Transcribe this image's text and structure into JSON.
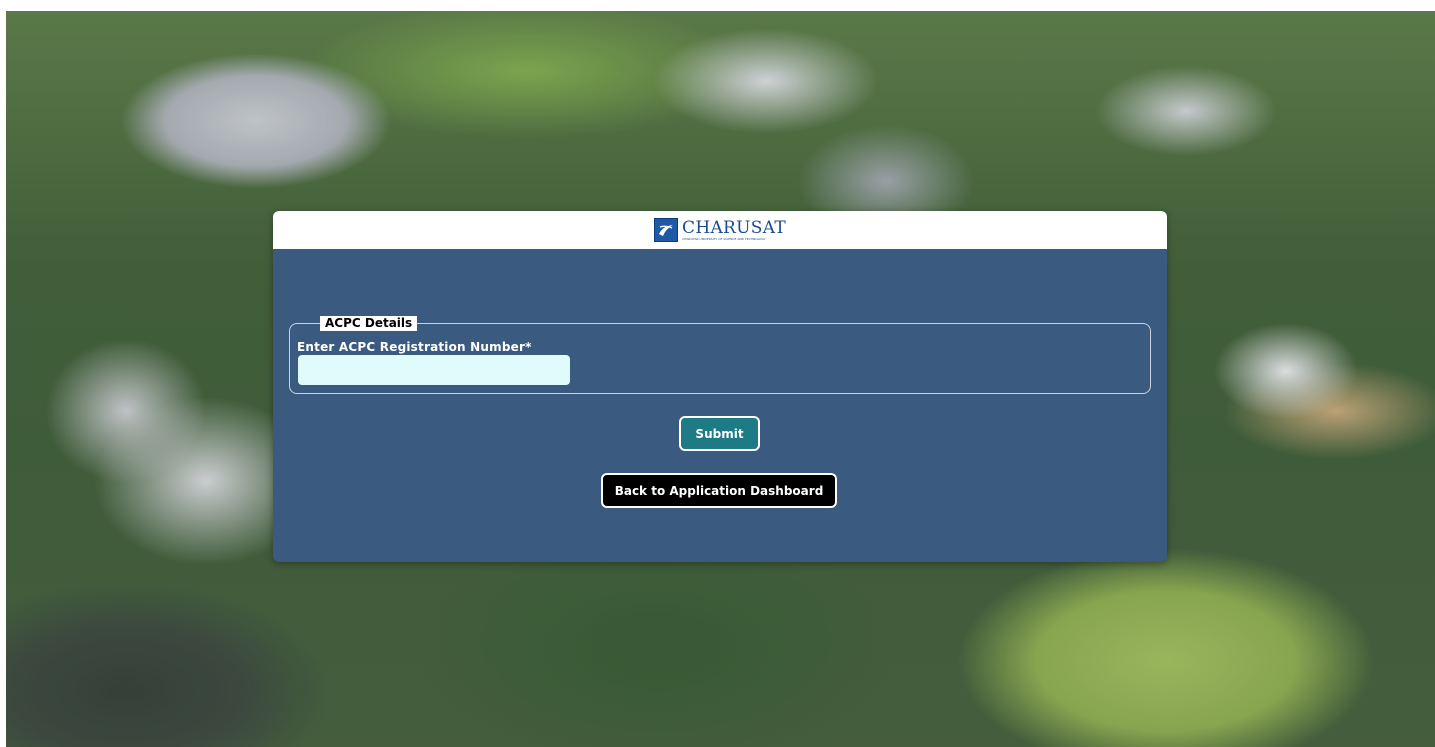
{
  "brand": {
    "name": "CHARUSAT",
    "subtitle": "CHAROTAR UNIVERSITY OF SCIENCE AND TECHNOLOGY"
  },
  "form": {
    "legend": "ACPC Details",
    "registration_label": "Enter ACPC Registration Number*",
    "registration_value": "",
    "submit_label": "Submit",
    "back_label": "Back to Application Dashboard"
  },
  "colors": {
    "card_bg": "#3a5a80",
    "submit_bg": "#1e7b86",
    "back_bg": "#000000",
    "input_bg": "#e0fbfc"
  }
}
